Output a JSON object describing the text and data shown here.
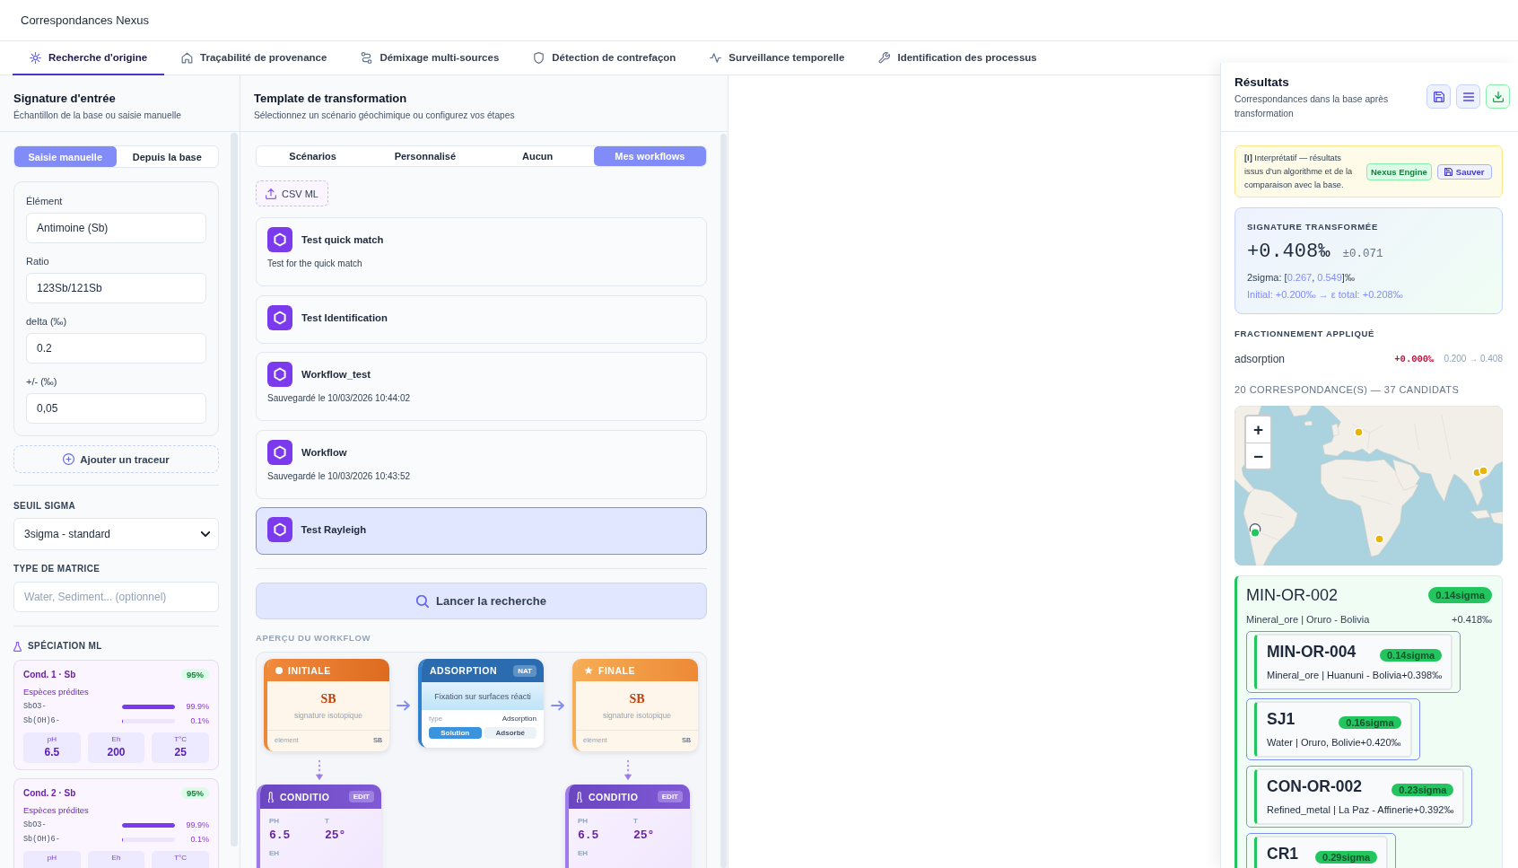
{
  "app": {
    "title": "Correspondances Nexus"
  },
  "tabs": [
    {
      "label": "Recherche d'origine",
      "selected": true
    },
    {
      "label": "Traçabilité de provenance",
      "selected": false
    },
    {
      "label": "Démixage multi-sources",
      "selected": false
    },
    {
      "label": "Détection de contrefaçon",
      "selected": false
    },
    {
      "label": "Surveillance temporelle",
      "selected": false
    },
    {
      "label": "Identification des processus",
      "selected": false
    }
  ],
  "input_panel": {
    "title": "Signature d'entrée",
    "subtitle": "Échantillon de la base ou saisie manuelle",
    "modes": [
      {
        "label": "Saisie manuelle",
        "selected": true
      },
      {
        "label": "Depuis la base",
        "selected": false
      }
    ],
    "fields": [
      {
        "label": "Élément",
        "value": "Antimoine (Sb)"
      },
      {
        "label": "Ratio",
        "value": "123Sb/121Sb"
      },
      {
        "label": "delta (‰)",
        "value": "0.2"
      },
      {
        "label": "+/- (‰)",
        "value": "0,05"
      }
    ],
    "add_tracer": "Ajouter un traceur",
    "sigma_threshold": {
      "label": "SEUIL SIGMA",
      "value": "3sigma - standard"
    },
    "matrix_type": {
      "label": "TYPE DE MATRICE",
      "placeholder": "Water, Sediment... (optionnel)"
    },
    "speciation": {
      "title": "SPÉCIATION ML",
      "conditions": [
        {
          "title": "Cond. 1 · Sb",
          "confidence": "95%",
          "species_label": "Espèces prédites",
          "species": [
            {
              "name": "SbO3-",
              "level": 0.999,
              "reading": "99.9%"
            },
            {
              "name": "Sb(OH)6-",
              "level": 0.001,
              "reading": "0.1%"
            }
          ],
          "params": [
            {
              "label": "pH",
              "value": "6.5"
            },
            {
              "label": "Eh",
              "value": "200"
            },
            {
              "label": "T°C",
              "value": "25"
            }
          ]
        },
        {
          "title": "Cond. 2 · Sb",
          "confidence": "95%",
          "species_label": "Espèces prédites",
          "species": [
            {
              "name": "SbO3-",
              "level": 0.999,
              "reading": "99.9%"
            },
            {
              "name": "Sb(OH)6-",
              "level": 0.001,
              "reading": "0.1%"
            }
          ],
          "params": [
            {
              "label": "pH"
            },
            {
              "label": "Eh"
            },
            {
              "label": "T°C"
            }
          ]
        }
      ]
    }
  },
  "template_panel": {
    "title": "Template de transformation",
    "subtitle": "Sélectionnez un scénario géochimique ou configurez vos étapes",
    "modes": [
      {
        "label": "Scénarios",
        "selected": false
      },
      {
        "label": "Personnalisé",
        "selected": false
      },
      {
        "label": "Aucun",
        "selected": false
      },
      {
        "label": "Mes workflows",
        "selected": true
      }
    ],
    "csv_button": "CSV ML",
    "workflows": [
      {
        "name": "Test quick match",
        "detail": "Test for the quick match",
        "selected": false
      },
      {
        "name": "Test Identification",
        "selected": false
      },
      {
        "name": "Workflow_test",
        "detail": "Sauvegardé le 10/03/2026 10:44:02",
        "selected": false
      },
      {
        "name": "Workflow",
        "detail": "Sauvegardé le 10/03/2026 10:43:52",
        "selected": false
      },
      {
        "name": "Test Rayleigh",
        "selected": true
      }
    ],
    "search_button": "Lancer la recherche",
    "preview": {
      "title": "APERÇU DU WORKFLOW",
      "nodes": [
        {
          "kind": "initial",
          "title": "INITIALE",
          "symbol": "SB",
          "caption": "signature isotopique",
          "footer_label": "élément",
          "footer_value": "SB",
          "condition": {
            "title": "CONDITIO",
            "badge": "EDIT",
            "params": [
              {
                "label": "PH",
                "value": "6.5"
              },
              {
                "label": "T",
                "value": "25°"
              },
              {
                "label": "EH"
              }
            ]
          }
        },
        {
          "kind": "process",
          "title": "ADSORPTION",
          "badge": "NAT",
          "description": "Fixation sur surfaces réacti",
          "field_label": "type",
          "field_value": "Adsorption",
          "phases": [
            {
              "label": "Solution",
              "selected": true
            },
            {
              "label": "Adsorbé",
              "selected": false
            }
          ]
        },
        {
          "kind": "final",
          "title": "FINALE",
          "symbol": "SB",
          "caption": "signature isotopique",
          "footer_label": "élément",
          "footer_value": "SB",
          "condition": {
            "title": "CONDITIO",
            "badge": "EDIT",
            "params": [
              {
                "label": "PH",
                "value": "6.5"
              },
              {
                "label": "T",
                "value": "25°"
              },
              {
                "label": "EH"
              }
            ]
          }
        }
      ]
    }
  },
  "results": {
    "title": "Résultats",
    "subtitle": "Correspondances dans la base après transformation",
    "notice": {
      "text": "**[I]** Interprétatif — résultats issus d'un algorithme et de la comparaison avec la base.",
      "engine": "Nexus Engine",
      "save": "Sauver"
    },
    "signature": {
      "title": "SIGNATURE TRANSFORMÉE",
      "value": "+0.408‰",
      "uncertainty": "±0.071",
      "interval": [
        {
          "text": "2sigma: [",
          "highlight": false
        },
        {
          "text": "0.267",
          "highlight": true
        },
        {
          "text": ", ",
          "highlight": false
        },
        {
          "text": "0.549",
          "highlight": true
        },
        {
          "text": "]‰",
          "highlight": false
        }
      ],
      "origin": "Initial: +0.200‰ → ε total: +0.208‰"
    },
    "fractionation": {
      "title": "FRACTIONNEMENT APPLIQUÉ",
      "steps": [
        {
          "name": "adsorption",
          "epsilon": "+0.000‰",
          "range": "0.200 → 0.408"
        }
      ]
    },
    "summary": "20 CORRESPONDANCE(S) — 37 CANDIDATS",
    "map": {
      "zoom_in": "+",
      "zoom_out": "−"
    },
    "matches": [
      {
        "id": "MIN-OR-002",
        "sigma": "0.14sigma",
        "info": "Mineral_ore | Oruro - Bolivia",
        "value": "+0.418‰",
        "children": [
          {
            "id": "MIN-OR-004",
            "sigma": "0.14sigma",
            "info": "Mineral_ore | Huanuni - Bolivia",
            "value": "+0.398‰"
          },
          {
            "id": "SJ1",
            "sigma": "0.16sigma",
            "info": "Water | Oruro, Bolivie",
            "value": "+0.420‰"
          },
          {
            "id": "CON-OR-002",
            "sigma": "0.23sigma",
            "info": "Refined_metal | La Paz - Affinerie",
            "value": "+0.392‰"
          },
          {
            "id": "CR1",
            "sigma": "0.29sigma"
          }
        ]
      }
    ]
  }
}
